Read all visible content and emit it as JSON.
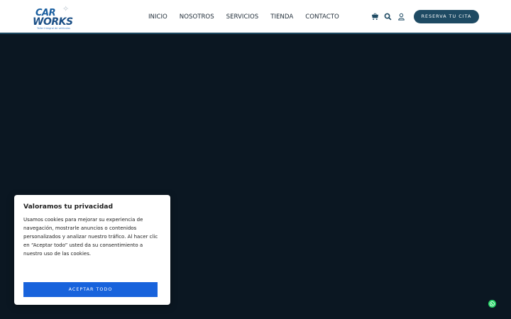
{
  "header": {
    "logo": {
      "line1": "CAR",
      "line2": "WORKS",
      "tagline": "Taller integral de vehículos"
    },
    "nav": [
      "INICIO",
      "NOSOTROS",
      "SERVICIOS",
      "TIENDA",
      "CONTACTO"
    ],
    "icons": [
      "cart-icon",
      "search-icon",
      "user-icon"
    ],
    "cta_label": "RESERVA TU CITA"
  },
  "cookie_banner": {
    "title": "Valoramos tu privacidad",
    "body": "Usamos cookies para mejorar su experiencia de navegación, mostrarle anuncios o contenidos personalizados y analizar nuestro tráfico. Al hacer clic en “Aceptar todo” usted da su consentimiento a nuestro uso de las cookies.",
    "accept_label": "ACEPTAR TODO"
  },
  "floating": {
    "icon": "whatsapp-icon"
  },
  "colors": {
    "hero_bg": "#0b1722",
    "brand": "#1e4a63",
    "accept_button": "#1863dc",
    "whatsapp": "#25d366"
  }
}
